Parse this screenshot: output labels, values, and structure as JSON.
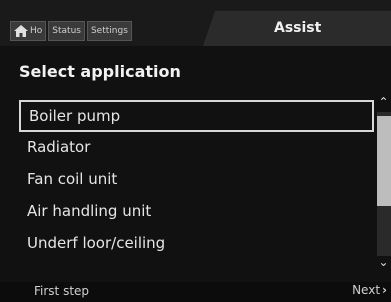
{
  "tabs": {
    "home_label": "Ho",
    "status_label": "Status",
    "settings_label": "Settings",
    "active_label": "Assist"
  },
  "page_title": "Select application",
  "list": [
    {
      "label": "Boiler pump",
      "selected": true
    },
    {
      "label": "Radiator",
      "selected": false
    },
    {
      "label": "Fan coil unit",
      "selected": false
    },
    {
      "label": "Air handling unit",
      "selected": false
    },
    {
      "label": "Underf loor/ceiling",
      "selected": false
    }
  ],
  "footer": {
    "back_label": "First step",
    "next_label": "Next"
  },
  "icons": {
    "home": "house-icon",
    "scroll_up": "chevron-up-icon",
    "scroll_down": "chevron-down-icon",
    "next": "chevron-right-icon"
  }
}
